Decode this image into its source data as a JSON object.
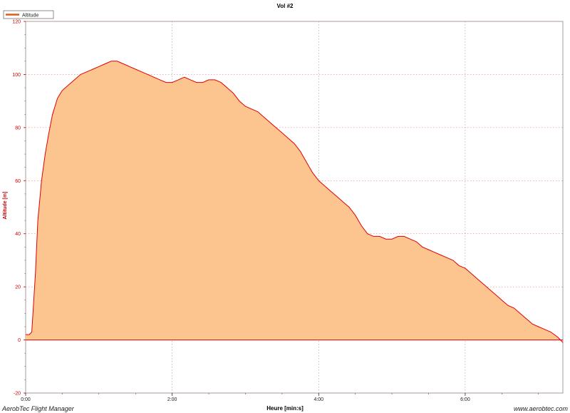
{
  "chart_data": {
    "type": "area",
    "title": "Vol #2",
    "xlabel": "Heure [min:s]",
    "ylabel": "Altitude [m]",
    "legend": {
      "label": "Altitude",
      "position": "top-left"
    },
    "x_unit": "seconds",
    "xlim": [
      0,
      440
    ],
    "ylim": [
      -20,
      120
    ],
    "y_ticks": [
      -20,
      0,
      20,
      40,
      60,
      80,
      100,
      120
    ],
    "y_tick_labels": [
      "-20",
      "0",
      "20",
      "40",
      "60",
      "80",
      "100",
      "120"
    ],
    "x_ticks": [
      0,
      120,
      240,
      360
    ],
    "x_tick_labels": [
      "0:00",
      "2:00",
      "4:00",
      "6:00"
    ],
    "grid": true,
    "colors": {
      "line": "#e00000",
      "fill": "#fcc58f",
      "zero_line": "#e00000",
      "grid": "#bbbbbb"
    },
    "series": [
      {
        "name": "Altitude",
        "x": [
          0,
          3,
          5,
          8,
          10,
          13,
          16,
          19,
          22,
          26,
          30,
          35,
          40,
          45,
          50,
          55,
          60,
          65,
          70,
          75,
          80,
          85,
          90,
          95,
          100,
          105,
          110,
          115,
          120,
          125,
          130,
          135,
          140,
          145,
          150,
          155,
          160,
          165,
          170,
          175,
          180,
          185,
          190,
          195,
          200,
          205,
          210,
          215,
          220,
          225,
          230,
          235,
          240,
          245,
          250,
          255,
          260,
          265,
          270,
          275,
          280,
          285,
          290,
          295,
          300,
          305,
          310,
          315,
          320,
          325,
          330,
          335,
          340,
          345,
          350,
          355,
          360,
          365,
          370,
          375,
          380,
          385,
          390,
          395,
          400,
          405,
          410,
          415,
          420,
          425,
          430,
          433,
          436,
          438,
          440
        ],
        "y": [
          2,
          2,
          3,
          25,
          45,
          60,
          70,
          78,
          85,
          91,
          94,
          96,
          98,
          100,
          101,
          102,
          103,
          104,
          105,
          105,
          104,
          103,
          102,
          101,
          100,
          99,
          98,
          97,
          97,
          98,
          99,
          98,
          97,
          97,
          98,
          98,
          97,
          95,
          93,
          90,
          88,
          87,
          86,
          84,
          82,
          80,
          78,
          76,
          74,
          71,
          67,
          63,
          60,
          58,
          56,
          54,
          52,
          50,
          47,
          43,
          40,
          39,
          39,
          38,
          38,
          39,
          39,
          38,
          37,
          35,
          34,
          33,
          32,
          31,
          30,
          28,
          27,
          25,
          23,
          21,
          19,
          17,
          15,
          13,
          12,
          10,
          8,
          6,
          5,
          4,
          3,
          2,
          1,
          0,
          -1
        ]
      }
    ]
  },
  "footer": {
    "left": "AerobTec Flight Manager",
    "right": "www.aerobtec.com"
  }
}
